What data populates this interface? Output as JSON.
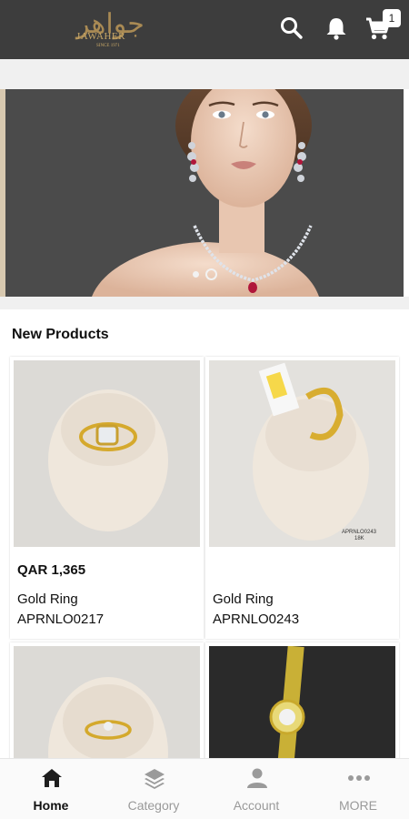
{
  "header": {
    "logo_arabic": "جواهر",
    "logo_english": "JAWAHER",
    "logo_since": "SINCE 1971",
    "cart_count": "1",
    "icons": [
      "search-icon",
      "bell-icon",
      "cart-icon"
    ]
  },
  "banner": {
    "slide_count": 2,
    "active_slide": 2
  },
  "new_products": {
    "title": "New Products",
    "items": [
      {
        "price": "QAR 1,365",
        "name": "Gold Ring",
        "code": "APRNLO0217"
      },
      {
        "price": "",
        "name": "Gold Ring",
        "code": "APRNLO0243",
        "tag_text": "APRNLO0243",
        "tag_karat": "18K"
      },
      {
        "price": "",
        "name": "",
        "code": ""
      },
      {
        "price": "",
        "name": "",
        "code": ""
      }
    ]
  },
  "bottom_nav": {
    "items": [
      {
        "label": "Home",
        "icon": "home-icon",
        "active": true
      },
      {
        "label": "Category",
        "icon": "layers-icon",
        "active": false
      },
      {
        "label": "Account",
        "icon": "person-icon",
        "active": false
      },
      {
        "label": "MORE",
        "icon": "more-dots-icon",
        "active": false
      }
    ]
  },
  "colors": {
    "appbar": "#3d3d3d",
    "logo_gold": "#a98a54",
    "banner_bg": "#4b4b4b",
    "nav_inactive": "#9a9a9a"
  }
}
